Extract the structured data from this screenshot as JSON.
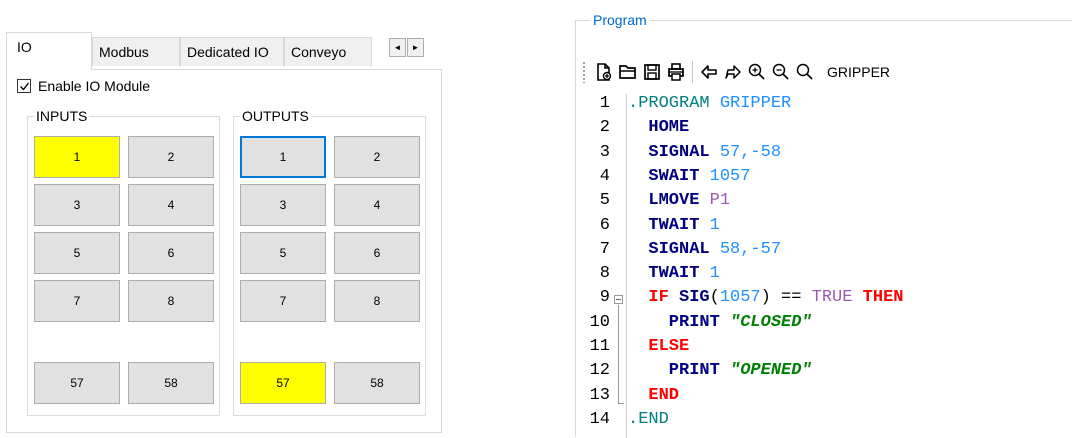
{
  "tabs": [
    {
      "label": "IO"
    },
    {
      "label": "Modbus"
    },
    {
      "label": "Dedicated IO"
    },
    {
      "label": "Conveyo"
    }
  ],
  "tab_scroll": {
    "left": "◄",
    "right": "►"
  },
  "enable_module": {
    "label": "Enable IO Module",
    "checked": true
  },
  "inputs": {
    "title": "INPUTS",
    "buttons": [
      "1",
      "2",
      "3",
      "4",
      "5",
      "6",
      "7",
      "8",
      "57",
      "58"
    ],
    "on": [
      "1"
    ]
  },
  "outputs": {
    "title": "OUTPUTS",
    "buttons": [
      "1",
      "2",
      "3",
      "4",
      "5",
      "6",
      "7",
      "8",
      "57",
      "58"
    ],
    "on": [
      "57"
    ],
    "focused": "1"
  },
  "program": {
    "title": "Program",
    "toolbar_label": "GRIPPER",
    "lines": [
      {
        "n": "1",
        "tokens": [
          {
            "t": ".PROGRAM ",
            "c": "dir"
          },
          {
            "t": "GRIPPER",
            "c": "ident"
          }
        ]
      },
      {
        "n": "2",
        "tokens": [
          {
            "t": "  HOME",
            "c": "kw"
          }
        ]
      },
      {
        "n": "3",
        "tokens": [
          {
            "t": "  SIGNAL ",
            "c": "kw"
          },
          {
            "t": "57,-58",
            "c": "num"
          }
        ]
      },
      {
        "n": "4",
        "tokens": [
          {
            "t": "  SWAIT ",
            "c": "kw"
          },
          {
            "t": "1057",
            "c": "num"
          }
        ]
      },
      {
        "n": "5",
        "tokens": [
          {
            "t": "  LMOVE ",
            "c": "kw"
          },
          {
            "t": "P1",
            "c": "const"
          }
        ]
      },
      {
        "n": "6",
        "tokens": [
          {
            "t": "  TWAIT ",
            "c": "kw"
          },
          {
            "t": "1",
            "c": "num"
          }
        ]
      },
      {
        "n": "7",
        "tokens": [
          {
            "t": "  SIGNAL ",
            "c": "kw"
          },
          {
            "t": "58,-57",
            "c": "num"
          }
        ]
      },
      {
        "n": "8",
        "tokens": [
          {
            "t": "  TWAIT ",
            "c": "kw"
          },
          {
            "t": "1",
            "c": "num"
          }
        ]
      },
      {
        "n": "9",
        "tokens": [
          {
            "t": "  IF ",
            "c": "kw-red"
          },
          {
            "t": "SIG",
            "c": "kw"
          },
          {
            "t": "(",
            "c": "op"
          },
          {
            "t": "1057",
            "c": "num"
          },
          {
            "t": ") == ",
            "c": "op"
          },
          {
            "t": "TRUE ",
            "c": "const"
          },
          {
            "t": "THEN",
            "c": "kw-red"
          }
        ]
      },
      {
        "n": "10",
        "tokens": [
          {
            "t": "    PRINT ",
            "c": "kw"
          },
          {
            "t": "\"CLOSED\"",
            "c": "str"
          }
        ]
      },
      {
        "n": "11",
        "tokens": [
          {
            "t": "  ELSE",
            "c": "kw-red"
          }
        ]
      },
      {
        "n": "12",
        "tokens": [
          {
            "t": "    PRINT ",
            "c": "kw"
          },
          {
            "t": "\"OPENED\"",
            "c": "str"
          }
        ]
      },
      {
        "n": "13",
        "tokens": [
          {
            "t": "  END",
            "c": "kw-red"
          }
        ]
      },
      {
        "n": "14",
        "tokens": [
          {
            "t": ".END",
            "c": "dir"
          }
        ]
      }
    ]
  },
  "colors": {
    "signal_on": "#ffff00",
    "focus_border": "#0078d7",
    "program_title": "#0066cc"
  },
  "icons": [
    "new-file-icon",
    "open-folder-icon",
    "save-icon",
    "print-icon",
    "undo-icon",
    "redo-icon",
    "zoom-in-icon",
    "zoom-out-icon",
    "search-icon"
  ]
}
